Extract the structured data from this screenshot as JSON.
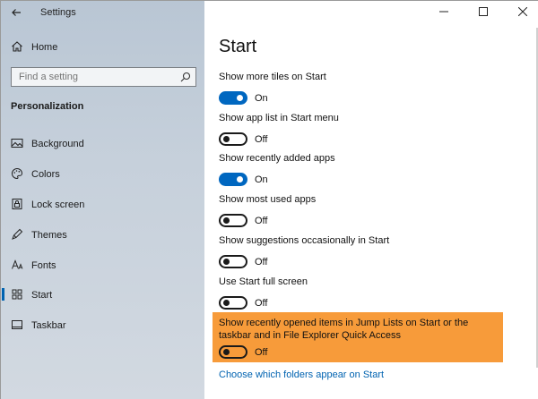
{
  "window": {
    "title": "Settings",
    "controls": {
      "minimize": "—",
      "maximize": "☐",
      "close": "✕"
    }
  },
  "sidebar": {
    "home_label": "Home",
    "search": {
      "placeholder": "Find a setting",
      "value": ""
    },
    "section_title": "Personalization",
    "items": [
      {
        "label": "Background",
        "icon": "background-icon"
      },
      {
        "label": "Colors",
        "icon": "palette-icon"
      },
      {
        "label": "Lock screen",
        "icon": "lock-screen-icon"
      },
      {
        "label": "Themes",
        "icon": "themes-icon"
      },
      {
        "label": "Fonts",
        "icon": "fonts-icon"
      },
      {
        "label": "Start",
        "icon": "start-icon",
        "selected": true
      },
      {
        "label": "Taskbar",
        "icon": "taskbar-icon"
      }
    ]
  },
  "main": {
    "title": "Start",
    "settings": [
      {
        "label": "Show more tiles on Start",
        "state": "On",
        "on": true
      },
      {
        "label": "Show app list in Start menu",
        "state": "Off",
        "on": false
      },
      {
        "label": "Show recently added apps",
        "state": "On",
        "on": true
      },
      {
        "label": "Show most used apps",
        "state": "Off",
        "on": false
      },
      {
        "label": "Show suggestions occasionally in Start",
        "state": "Off",
        "on": false
      },
      {
        "label": "Use Start full screen",
        "state": "Off",
        "on": false
      }
    ],
    "highlighted_setting": {
      "label": "Show recently opened items in Jump Lists on Start or the taskbar and in File Explorer Quick Access",
      "state": "Off",
      "on": false,
      "highlight_color": "#f79b3a"
    },
    "link": "Choose which folders appear on Start"
  },
  "colors": {
    "accent": "#0067c0",
    "link": "#0063b1"
  }
}
